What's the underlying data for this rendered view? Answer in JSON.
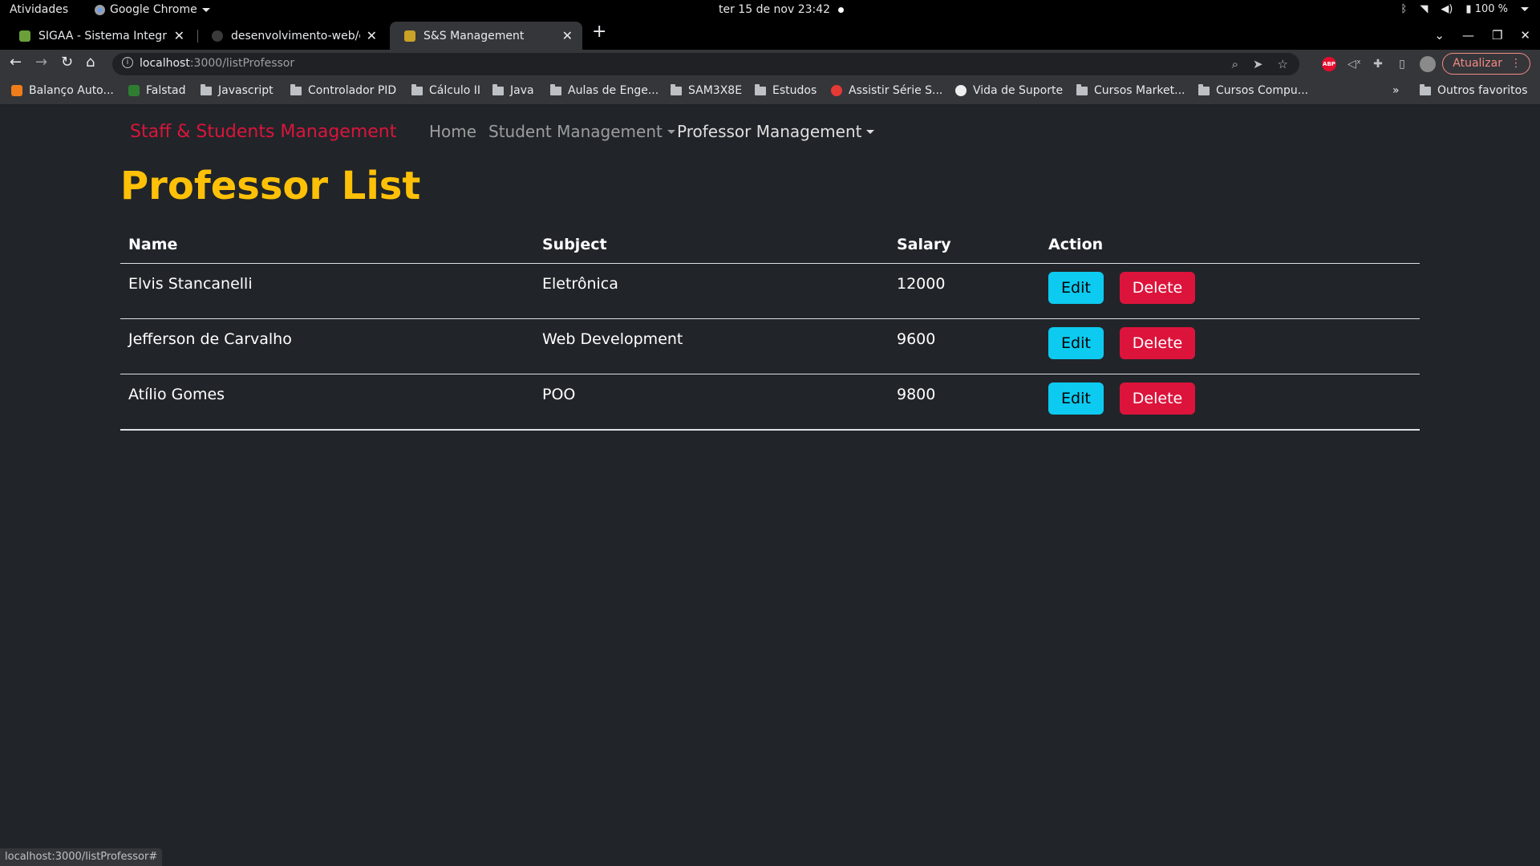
{
  "os": {
    "activities": "Atividades",
    "app_name": "Google Chrome",
    "clock": "ter 15 de nov  23:42",
    "battery": "100 %"
  },
  "tabs": [
    {
      "title": "SIGAA - Sistema Integrado",
      "favicon_color": "#6a9f3a"
    },
    {
      "title": "desenvolvimento-web/crud",
      "favicon_color": "#3a3a3a"
    },
    {
      "title": "S&S Management",
      "favicon_color": "#c9a227"
    }
  ],
  "address": {
    "host": "localhost",
    "path": ":3000/listProfessor"
  },
  "toolbar": {
    "update_label": "Atualizar"
  },
  "bookmarks": [
    {
      "label": "Balanço Auto...",
      "type": "site",
      "color": "#f07d1a"
    },
    {
      "label": "Falstad",
      "type": "site",
      "color": "#2e7d32"
    },
    {
      "label": "Javascript",
      "type": "folder"
    },
    {
      "label": "Controlador PID",
      "type": "folder"
    },
    {
      "label": "Cálculo II",
      "type": "folder"
    },
    {
      "label": "Java",
      "type": "folder"
    },
    {
      "label": "Aulas de Enge...",
      "type": "folder"
    },
    {
      "label": "SAM3X8E",
      "type": "folder"
    },
    {
      "label": "Estudos",
      "type": "folder"
    },
    {
      "label": "Assistir Série S...",
      "type": "site",
      "color": "#e53935"
    },
    {
      "label": "Vida de Suporte",
      "type": "site",
      "color": "#eeeeee"
    },
    {
      "label": "Cursos Market...",
      "type": "folder"
    },
    {
      "label": "Cursos Compu...",
      "type": "folder"
    }
  ],
  "bookmarks_more": "»",
  "bookmarks_other": "Outros favoritos",
  "nav": {
    "brand": "Staff & Students Management",
    "home": "Home",
    "student": "Student Management",
    "professor": "Professor Management"
  },
  "heading": "Professor List",
  "table": {
    "headers": [
      "Name",
      "Subject",
      "Salary",
      "Action"
    ],
    "rows": [
      {
        "name": "Elvis Stancanelli",
        "subject": "Eletrônica",
        "salary": "12000"
      },
      {
        "name": "Jefferson de Carvalho",
        "subject": "Web Development",
        "salary": "9600"
      },
      {
        "name": "Atílio Gomes",
        "subject": "POO",
        "salary": "9800"
      }
    ],
    "edit_label": "Edit",
    "delete_label": "Delete"
  },
  "status_url": "localhost:3000/listProfessor#",
  "colors": {
    "brand": "#dc143c",
    "heading": "#ffc107",
    "edit": "#0dcaf0",
    "delete": "#dc143c",
    "background": "#212529"
  }
}
